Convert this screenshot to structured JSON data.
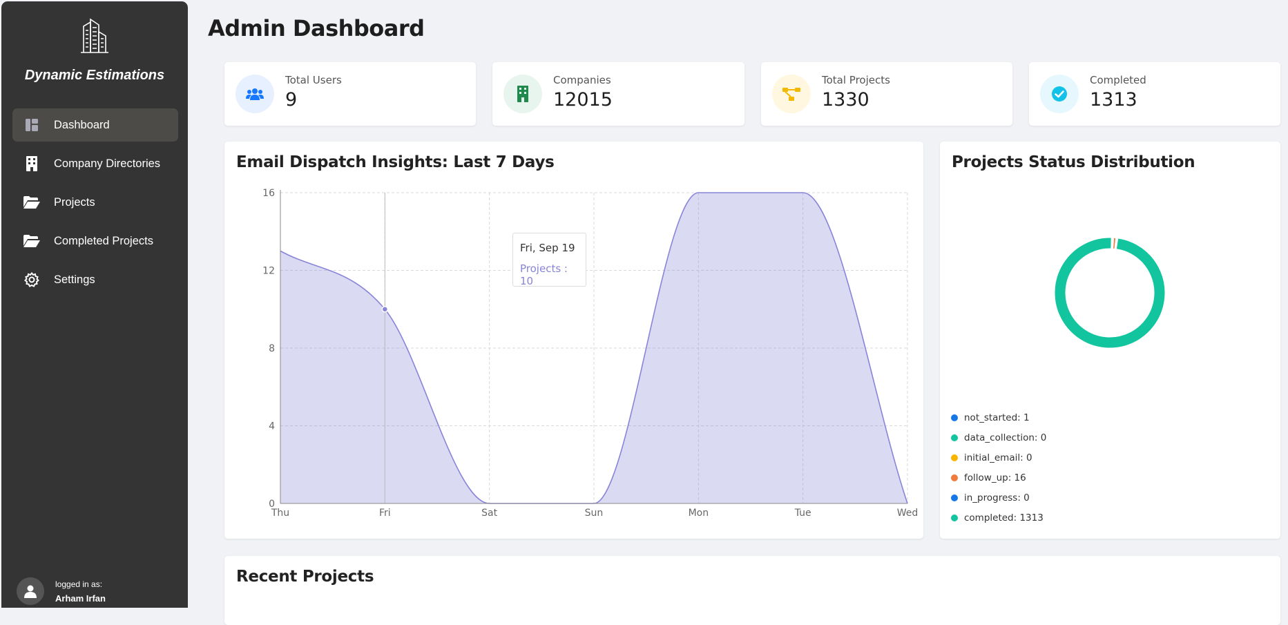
{
  "sidebar": {
    "brand": "Dynamic Estimations",
    "items": [
      {
        "label": "Dashboard",
        "icon": "dashboard-icon",
        "active": true
      },
      {
        "label": "Company Directories",
        "icon": "building-icon"
      },
      {
        "label": "Projects",
        "icon": "folder-open-icon"
      },
      {
        "label": "Completed Projects",
        "icon": "folder-open-icon"
      },
      {
        "label": "Settings",
        "icon": "gear-icon"
      }
    ],
    "user": {
      "logged_in_label": "logged in as:",
      "name": "Arham Irfan"
    }
  },
  "page_title": "Admin Dashboard",
  "stats": [
    {
      "label": "Total Users",
      "value": "9",
      "icon": "users-icon",
      "color": "#1677ff",
      "bg": "#e7f0ff"
    },
    {
      "label": "Companies",
      "value": "12015",
      "icon": "building-icon",
      "color": "#1f8a4c",
      "bg": "#e8f5ee"
    },
    {
      "label": "Total Projects",
      "value": "1330",
      "icon": "project-diagram-icon",
      "color": "#f5b800",
      "bg": "#fff7e0"
    },
    {
      "label": "Completed",
      "value": "1313",
      "icon": "check-circle-icon",
      "color": "#13c2e8",
      "bg": "#e6f8fd"
    }
  ],
  "email_chart": {
    "title": "Email Dispatch Insights: Last 7 Days",
    "tooltip": {
      "date": "Fri, Sep 19",
      "text": "Projects : 10"
    }
  },
  "status_chart": {
    "title": "Projects Status Distribution",
    "legend": [
      {
        "label": "not_started: 1",
        "color": "#1677e6"
      },
      {
        "label": "data_collection: 0",
        "color": "#12c59e"
      },
      {
        "label": "initial_email: 0",
        "color": "#fab400"
      },
      {
        "label": "follow_up: 16",
        "color": "#f07a3a"
      },
      {
        "label": "in_progress: 0",
        "color": "#1677e6"
      },
      {
        "label": "completed: 1313",
        "color": "#12c59e"
      }
    ]
  },
  "recent": {
    "title": "Recent Projects"
  },
  "chart_data": [
    {
      "type": "area",
      "title": "Email Dispatch Insights: Last 7 Days",
      "categories": [
        "Thu",
        "Fri",
        "Sat",
        "Sun",
        "Mon",
        "Tue",
        "Wed"
      ],
      "series": [
        {
          "name": "Projects",
          "values": [
            13,
            10,
            0,
            0,
            16,
            16,
            0
          ],
          "color": "#8884d8"
        }
      ],
      "yticks": [
        0,
        4,
        8,
        12,
        16
      ],
      "ylim": [
        0,
        16
      ],
      "grid": true
    },
    {
      "type": "pie",
      "title": "Projects Status Distribution",
      "labels": [
        "not_started",
        "data_collection",
        "initial_email",
        "follow_up",
        "in_progress",
        "completed"
      ],
      "values": [
        1,
        0,
        0,
        16,
        0,
        1313
      ],
      "colors": [
        "#1677e6",
        "#12c59e",
        "#fab400",
        "#f07a3a",
        "#1677e6",
        "#12c59e"
      ]
    }
  ]
}
